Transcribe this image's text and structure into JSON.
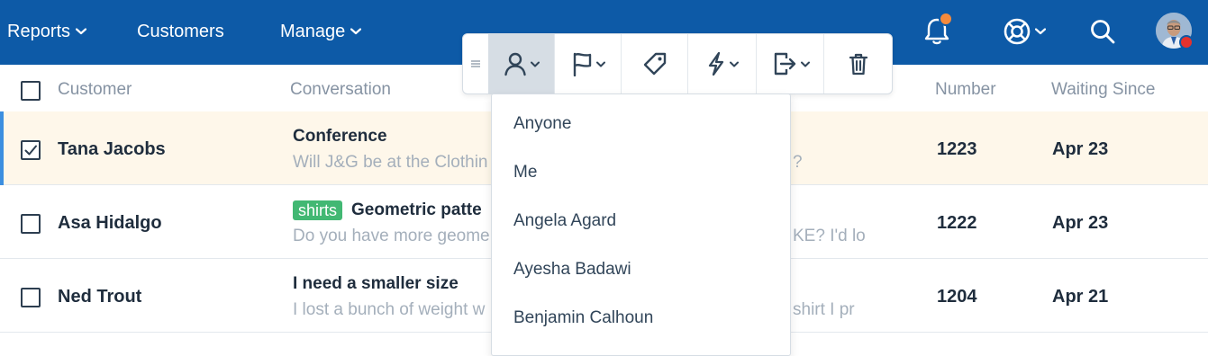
{
  "nav": {
    "reports": "Reports",
    "customers": "Customers",
    "manage": "Manage",
    "icons": [
      "bell-icon",
      "lifebuoy-icon",
      "search-icon",
      "avatar"
    ],
    "brand_color": "#0d5aa7",
    "notification_color": "#f58a3c"
  },
  "table": {
    "headers": {
      "customer": "Customer",
      "conversation": "Conversation",
      "number": "Number",
      "waiting_since": "Waiting Since"
    },
    "rows": [
      {
        "customer": "Tana Jacobs",
        "checked": true,
        "tag": "",
        "subject": "Conference",
        "preview": "Will J&G be at the Clothin",
        "preview_tail": "?",
        "number": "1223",
        "waiting_since": "Apr 23"
      },
      {
        "customer": "Asa Hidalgo",
        "checked": false,
        "tag": "shirts",
        "subject": "Geometric patte",
        "preview": "Do you have more geome",
        "preview_tail": "KE? I'd lov",
        "number": "1222",
        "waiting_since": "Apr 23"
      },
      {
        "customer": "Ned Trout",
        "checked": false,
        "tag": "",
        "subject": "I need a smaller size",
        "preview": "I lost a bunch of weight w",
        "preview_tail": "shirt I pr",
        "number": "1204",
        "waiting_since": "Apr 21"
      }
    ]
  },
  "toolbar": {
    "buttons": [
      "assign-icon",
      "flag-icon",
      "tag-icon",
      "workflow-icon",
      "move-icon",
      "trash-icon"
    ],
    "active": "assign-icon"
  },
  "dropdown": {
    "options": [
      "Anyone",
      "Me",
      "Angela Agard",
      "Ayesha Badawi",
      "Benjamin Calhoun"
    ]
  },
  "colors": {
    "selected_row_bg": "#fef7ea",
    "selected_row_accent": "#3c8fe0",
    "tag_green": "#42b873"
  }
}
